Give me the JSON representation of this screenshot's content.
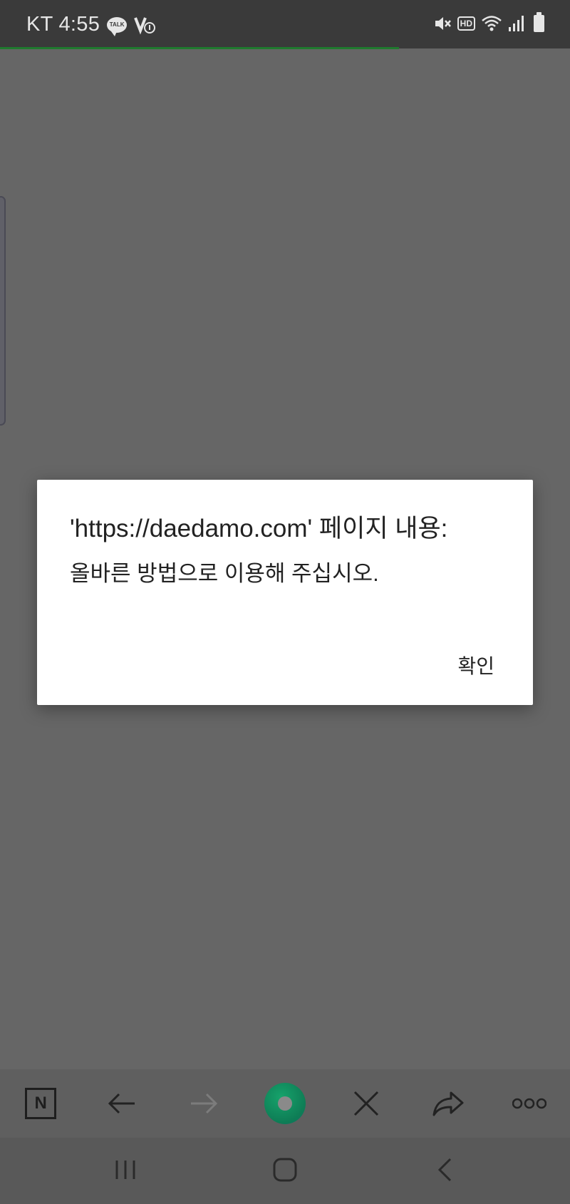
{
  "status_bar": {
    "carrier_time": "KT 4:55",
    "talk_badge": "TALK",
    "hd_badge": "HD",
    "icons": [
      "kakaotalk-icon",
      "v-notification-icon",
      "mute-icon",
      "hd-voice-icon",
      "wifi-icon",
      "signal-icon",
      "battery-icon"
    ]
  },
  "dialog": {
    "title": "'https://daedamo.com' 페이지 내용:",
    "message": "올바른 방법으로 이용해 주십시오.",
    "ok_label": "확인"
  },
  "toolbar": {
    "naver_letter": "N",
    "icons": [
      "naver-icon",
      "back-arrow-icon",
      "forward-arrow-icon",
      "home-orb-icon",
      "close-icon",
      "share-icon",
      "more-icon"
    ]
  },
  "nav_bar": {
    "icons": [
      "recent-apps-icon",
      "home-icon",
      "back-icon"
    ]
  },
  "colors": {
    "background": "#666666",
    "status_bar": "#3a3a3a",
    "progress": "#1f7a2e",
    "dialog": "#ffffff",
    "orb": "#0e7c55"
  }
}
